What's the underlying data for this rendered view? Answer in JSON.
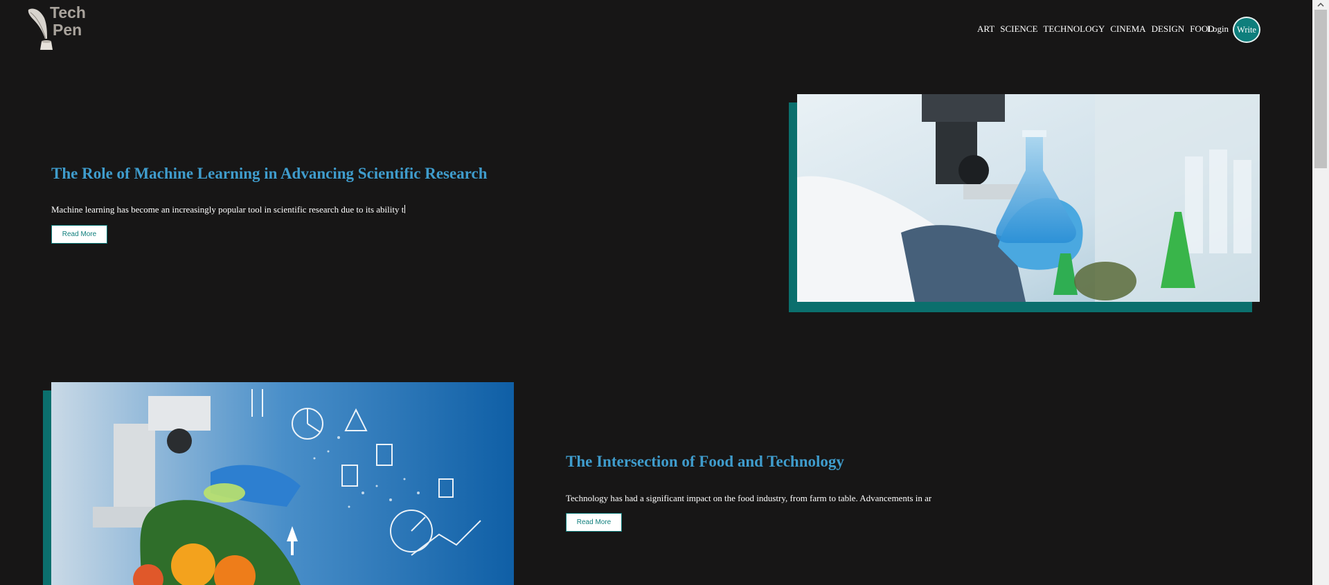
{
  "brand": {
    "line1": "Tech",
    "line2": "Pen"
  },
  "nav": {
    "links": [
      "ART",
      "SCIENCE",
      "TECHNOLOGY",
      "CINEMA",
      "DESIGN",
      "FOOD"
    ],
    "login": "Login",
    "write": "Write"
  },
  "articles": [
    {
      "title": "The Role of Machine Learning in Advancing Scientific Research",
      "excerpt": "Machine learning has become an increasingly popular tool in scientific research due to its ability t",
      "read_more": "Read More"
    },
    {
      "title": "The Intersection of Food and Technology",
      "excerpt": "Technology has had a significant impact on the food industry, from farm to table. Advancements in ar",
      "read_more": "Read More"
    }
  ],
  "colors": {
    "background": "#171616",
    "accent_teal": "#0e7e7c",
    "title_blue": "#3f9ccc"
  },
  "icons": [
    "quill-logo-icon",
    "scroll-up-icon"
  ]
}
